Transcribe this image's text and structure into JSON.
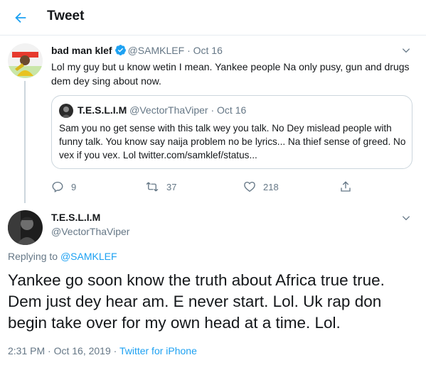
{
  "header": {
    "title": "Tweet"
  },
  "colors": {
    "accent": "#1da1f2",
    "secondary_text": "#657786",
    "border": "#e6ecf0"
  },
  "icons": {
    "back": "arrow-left-icon",
    "verified": "verified-badge-icon",
    "more": "chevron-down-icon",
    "reply": "reply-icon",
    "retweet": "retweet-icon",
    "like": "heart-icon",
    "share": "share-icon"
  },
  "parent_tweet": {
    "name": "bad man klef",
    "handle": "@SAMKLEF",
    "separator": "·",
    "date": "Oct 16",
    "text": "Lol my guy but u know wetin I mean.  Yankee people Na only pusy, gun and drugs dem dey sing about now.",
    "quote": {
      "name": "T.E.S.L.I.M",
      "handle": "@VectorThaViper",
      "separator": "·",
      "date": "Oct 16",
      "text": "Sam you no get sense with this talk wey you talk. No Dey mislead people with funny talk. You know say naija problem no be lyrics... Na thief sense of greed. No vex if you vex. Lol twitter.com/samklef/status..."
    },
    "stats": {
      "replies": "9",
      "retweets": "37",
      "likes": "218"
    }
  },
  "main_tweet": {
    "name": "T.E.S.L.I.M",
    "handle": "@VectorThaViper",
    "replying_prefix": "Replying to",
    "replying_to": "@SAMKLEF",
    "text": "Yankee go soon know the truth about Africa true true. Dem just dey hear am. E never start. Lol. Uk rap don begin take over for my own head at a time. Lol.",
    "timestamp": "2:31 PM · Oct 16, 2019 ·",
    "source": "Twitter for iPhone"
  }
}
